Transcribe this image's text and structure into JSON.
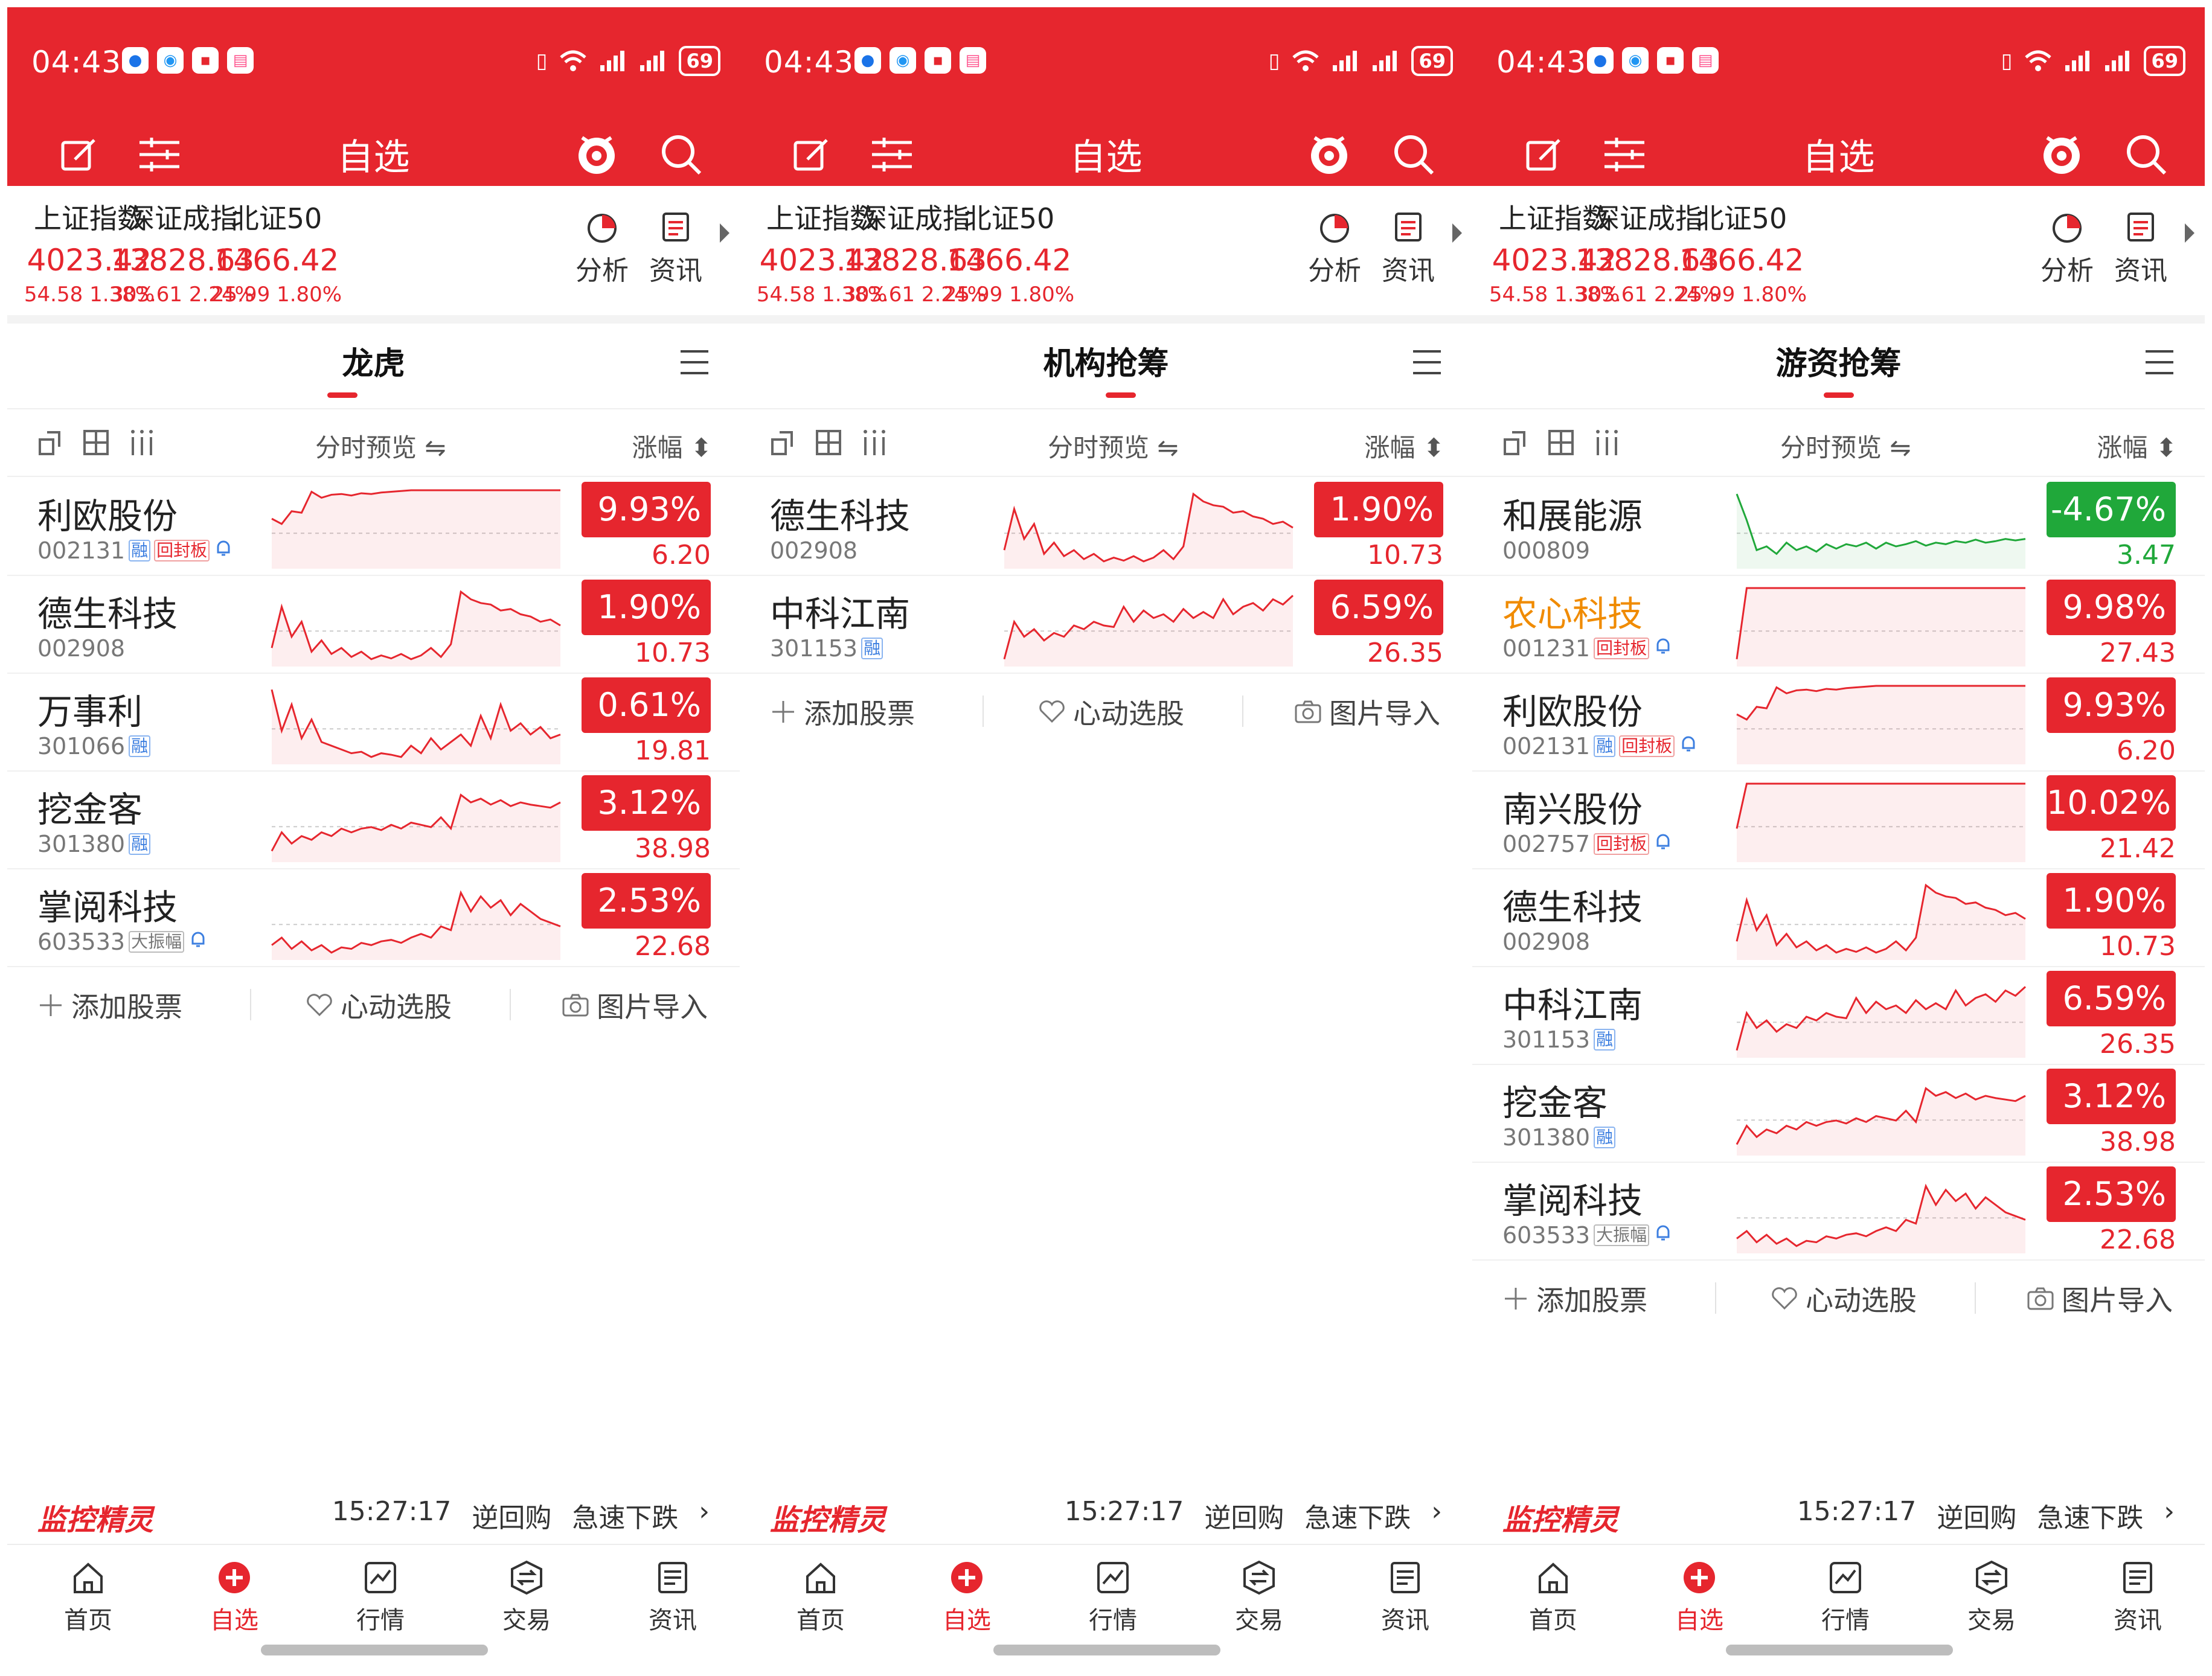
{
  "status": {
    "time": "04:43",
    "battery": "69"
  },
  "appbar": {
    "title": "自选"
  },
  "indices": [
    {
      "name": "上证指数",
      "value": "4023.42",
      "change": "54.58",
      "pct": "1.38%"
    },
    {
      "name": "深证成指",
      "value": "13828.63",
      "change": "303.61",
      "pct": "2.24%"
    },
    {
      "name": "北证50",
      "value": "1466.42",
      "change": "25.99",
      "pct": "1.80%"
    }
  ],
  "quick_actions": {
    "analysis": "分析",
    "news": "资讯"
  },
  "columns": {
    "preview": "分时预览 ⇋",
    "change": "涨幅 ⬍"
  },
  "add_actions": {
    "add": "添加股票",
    "pick": "心动选股",
    "import": "图片导入"
  },
  "ticker": {
    "logo": "监控精灵",
    "time": "15:27:17",
    "event1": "逆回购",
    "event2": "急速下跌",
    "arrow": "›"
  },
  "nav": [
    "首页",
    "自选",
    "行情",
    "交易",
    "资讯"
  ],
  "colors": {
    "accent": "#e6262e",
    "down": "#20a83a"
  },
  "panels": [
    {
      "tab": "龙虎",
      "stocks": [
        {
          "name": "利欧股份",
          "code": "002131",
          "tags": [
            "融",
            "回封板",
            "bell"
          ],
          "change": "9.93%",
          "price": "6.20",
          "dir": "up",
          "spark": [
            0.62,
            0.55,
            0.72,
            0.7,
            0.98,
            0.9,
            0.94,
            0.95,
            0.93,
            0.96,
            0.95,
            0.97,
            0.98,
            0.99,
            1,
            1,
            1,
            1,
            1,
            1,
            1,
            1,
            1,
            1,
            1,
            1,
            1,
            1,
            1,
            1
          ]
        },
        {
          "name": "德生科技",
          "code": "002908",
          "tags": [],
          "change": "1.90%",
          "price": "10.73",
          "dir": "up",
          "spark": [
            0.2,
            0.75,
            0.35,
            0.55,
            0.15,
            0.3,
            0.12,
            0.2,
            0.08,
            0.15,
            0.05,
            0.1,
            0.06,
            0.12,
            0.05,
            0.1,
            0.2,
            0.08,
            0.25,
            0.95,
            0.85,
            0.8,
            0.78,
            0.7,
            0.72,
            0.65,
            0.62,
            0.55,
            0.58,
            0.5
          ]
        },
        {
          "name": "万事利",
          "code": "301066",
          "tags": [
            "融"
          ],
          "change": "0.61%",
          "price": "19.81",
          "dir": "up",
          "spark": [
            0.95,
            0.4,
            0.75,
            0.3,
            0.55,
            0.25,
            0.2,
            0.15,
            0.1,
            0.12,
            0.05,
            0.1,
            0.08,
            0.05,
            0.2,
            0.1,
            0.3,
            0.15,
            0.25,
            0.35,
            0.2,
            0.6,
            0.3,
            0.75,
            0.4,
            0.5,
            0.35,
            0.45,
            0.3,
            0.35
          ]
        },
        {
          "name": "挖金客",
          "code": "301380",
          "tags": [
            "融"
          ],
          "change": "3.12%",
          "price": "38.98",
          "dir": "up",
          "spark": [
            0.1,
            0.35,
            0.2,
            0.3,
            0.25,
            0.35,
            0.3,
            0.4,
            0.35,
            0.4,
            0.42,
            0.38,
            0.45,
            0.4,
            0.48,
            0.45,
            0.42,
            0.55,
            0.4,
            0.85,
            0.75,
            0.8,
            0.72,
            0.78,
            0.7,
            0.75,
            0.72,
            0.7,
            0.68,
            0.75
          ]
        },
        {
          "name": "掌阅科技",
          "code": "603533",
          "tags": [
            "大振幅",
            "bell"
          ],
          "change": "2.53%",
          "price": "22.68",
          "dir": "up",
          "spark": [
            0.15,
            0.25,
            0.1,
            0.2,
            0.08,
            0.15,
            0.05,
            0.12,
            0.1,
            0.18,
            0.15,
            0.2,
            0.22,
            0.18,
            0.25,
            0.3,
            0.25,
            0.4,
            0.35,
            0.85,
            0.6,
            0.8,
            0.65,
            0.75,
            0.55,
            0.7,
            0.6,
            0.5,
            0.45,
            0.4
          ]
        }
      ]
    },
    {
      "tab": "机构抢筹",
      "stocks": [
        {
          "name": "德生科技",
          "code": "002908",
          "tags": [],
          "change": "1.90%",
          "price": "10.73",
          "dir": "up",
          "spark": [
            0.2,
            0.75,
            0.35,
            0.55,
            0.15,
            0.3,
            0.12,
            0.2,
            0.08,
            0.15,
            0.05,
            0.1,
            0.06,
            0.12,
            0.05,
            0.1,
            0.2,
            0.08,
            0.25,
            0.95,
            0.85,
            0.8,
            0.78,
            0.7,
            0.72,
            0.65,
            0.62,
            0.55,
            0.58,
            0.5
          ]
        },
        {
          "name": "中科江南",
          "code": "301153",
          "tags": [
            "融"
          ],
          "change": "6.59%",
          "price": "26.35",
          "dir": "up",
          "spark": [
            0.05,
            0.55,
            0.35,
            0.45,
            0.3,
            0.4,
            0.35,
            0.5,
            0.45,
            0.55,
            0.5,
            0.48,
            0.75,
            0.55,
            0.7,
            0.6,
            0.65,
            0.55,
            0.72,
            0.6,
            0.68,
            0.6,
            0.85,
            0.65,
            0.75,
            0.8,
            0.7,
            0.85,
            0.78,
            0.9
          ]
        }
      ]
    },
    {
      "tab": "游资抢筹",
      "stocks": [
        {
          "name": "和展能源",
          "code": "000809",
          "tags": [],
          "change": "-4.67%",
          "price": "3.47",
          "dir": "down",
          "highlight": false,
          "spark": [
            0.95,
            0.6,
            0.2,
            0.25,
            0.15,
            0.3,
            0.2,
            0.25,
            0.18,
            0.28,
            0.22,
            0.28,
            0.25,
            0.3,
            0.22,
            0.3,
            0.25,
            0.28,
            0.32,
            0.26,
            0.3,
            0.28,
            0.32,
            0.3,
            0.34,
            0.3,
            0.32,
            0.35,
            0.33,
            0.35
          ]
        },
        {
          "name": "农心科技",
          "code": "001231",
          "tags": [
            "回封板",
            "bell"
          ],
          "change": "9.98%",
          "price": "27.43",
          "dir": "up",
          "highlight": true,
          "spark": [
            0.05,
            1,
            1,
            1,
            1,
            1,
            1,
            1,
            1,
            1,
            1,
            1,
            1,
            1,
            1,
            1,
            1,
            1,
            1,
            1,
            1,
            1,
            1,
            1,
            1,
            1,
            1,
            1,
            1,
            1
          ]
        },
        {
          "name": "利欧股份",
          "code": "002131",
          "tags": [
            "融",
            "回封板",
            "bell"
          ],
          "change": "9.93%",
          "price": "6.20",
          "dir": "up",
          "highlight": false,
          "spark": [
            0.62,
            0.55,
            0.72,
            0.7,
            0.98,
            0.9,
            0.94,
            0.95,
            0.93,
            0.96,
            0.95,
            0.97,
            0.98,
            0.99,
            1,
            1,
            1,
            1,
            1,
            1,
            1,
            1,
            1,
            1,
            1,
            1,
            1,
            1,
            1,
            1
          ]
        },
        {
          "name": "南兴股份",
          "code": "002757",
          "tags": [
            "回封板",
            "bell"
          ],
          "change": "10.02%",
          "price": "21.42",
          "dir": "up",
          "highlight": false,
          "spark": [
            0.4,
            1,
            1,
            1,
            1,
            1,
            1,
            1,
            1,
            1,
            1,
            1,
            1,
            1,
            1,
            1,
            1,
            1,
            1,
            1,
            1,
            1,
            1,
            1,
            1,
            1,
            1,
            1,
            1,
            1
          ]
        },
        {
          "name": "德生科技",
          "code": "002908",
          "tags": [],
          "change": "1.90%",
          "price": "10.73",
          "dir": "up",
          "highlight": false,
          "spark": [
            0.2,
            0.75,
            0.35,
            0.55,
            0.15,
            0.3,
            0.12,
            0.2,
            0.08,
            0.15,
            0.05,
            0.1,
            0.06,
            0.12,
            0.05,
            0.1,
            0.2,
            0.08,
            0.25,
            0.95,
            0.85,
            0.8,
            0.78,
            0.7,
            0.72,
            0.65,
            0.62,
            0.55,
            0.58,
            0.5
          ]
        },
        {
          "name": "中科江南",
          "code": "301153",
          "tags": [
            "融"
          ],
          "change": "6.59%",
          "price": "26.35",
          "dir": "up",
          "highlight": false,
          "spark": [
            0.05,
            0.55,
            0.35,
            0.45,
            0.3,
            0.4,
            0.35,
            0.5,
            0.45,
            0.55,
            0.5,
            0.48,
            0.75,
            0.55,
            0.7,
            0.6,
            0.65,
            0.55,
            0.72,
            0.6,
            0.68,
            0.6,
            0.85,
            0.65,
            0.75,
            0.8,
            0.7,
            0.85,
            0.78,
            0.9
          ]
        },
        {
          "name": "挖金客",
          "code": "301380",
          "tags": [
            "融"
          ],
          "change": "3.12%",
          "price": "38.98",
          "dir": "up",
          "highlight": false,
          "spark": [
            0.1,
            0.35,
            0.2,
            0.3,
            0.25,
            0.35,
            0.3,
            0.4,
            0.35,
            0.4,
            0.42,
            0.38,
            0.45,
            0.4,
            0.48,
            0.45,
            0.42,
            0.55,
            0.4,
            0.85,
            0.75,
            0.8,
            0.72,
            0.78,
            0.7,
            0.75,
            0.72,
            0.7,
            0.68,
            0.75
          ]
        },
        {
          "name": "掌阅科技",
          "code": "603533",
          "tags": [
            "大振幅",
            "bell"
          ],
          "change": "2.53%",
          "price": "22.68",
          "dir": "up",
          "highlight": false,
          "spark": [
            0.15,
            0.25,
            0.1,
            0.2,
            0.08,
            0.15,
            0.05,
            0.12,
            0.1,
            0.18,
            0.15,
            0.2,
            0.22,
            0.18,
            0.25,
            0.3,
            0.25,
            0.4,
            0.35,
            0.85,
            0.6,
            0.8,
            0.65,
            0.75,
            0.55,
            0.7,
            0.6,
            0.5,
            0.45,
            0.4
          ]
        }
      ]
    }
  ]
}
